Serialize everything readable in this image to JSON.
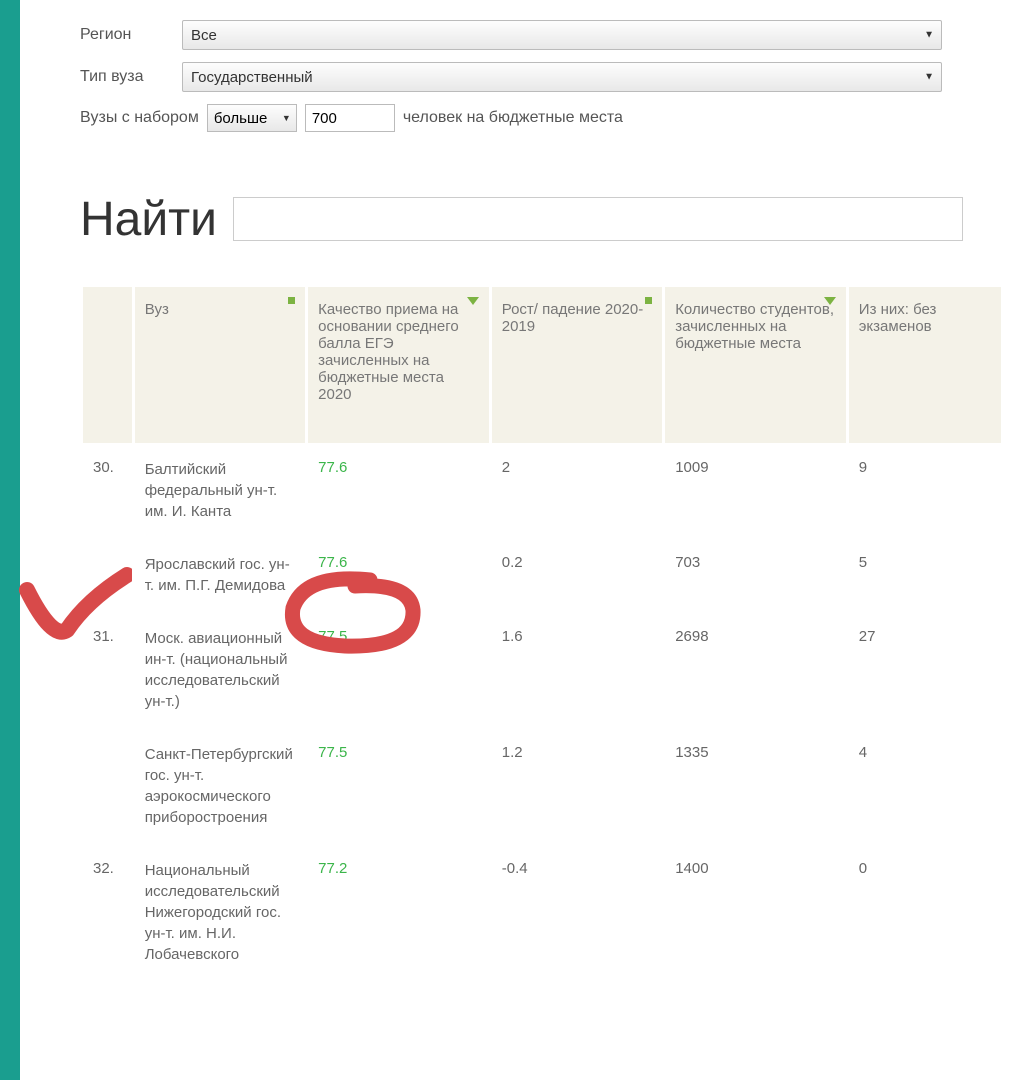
{
  "filters": {
    "region_label": "Регион",
    "region_value": "Все",
    "type_label": "Тип вуза",
    "type_value": "Государственный",
    "enroll_prefix": "Вузы с набором",
    "comparator": "больше",
    "threshold": "700",
    "enroll_suffix": "человек на бюджетные места"
  },
  "search": {
    "heading": "Найти",
    "value": ""
  },
  "columns": {
    "rank": "",
    "name": "Вуз",
    "quality": "Качество приема на основании среднего балла ЕГЭ зачисленных на бюджетные места 2020",
    "growth": "Рост/ падение 2020-2019",
    "students": "Количество студентов, зачисленных на бюджетные места",
    "noexam": "Из них: без экзаменов"
  },
  "rows": [
    {
      "rank": "30.",
      "name": "Балтийский федеральный ун-т. им. И. Канта",
      "quality": "77.6",
      "growth": "2",
      "students": "1009",
      "noexam": "9"
    },
    {
      "rank": "",
      "name": "Ярославский гос. ун-т. им. П.Г. Демидова",
      "quality": "77.6",
      "growth": "0.2",
      "students": "703",
      "noexam": "5"
    },
    {
      "rank": "31.",
      "name": "Моск. авиационный ин-т. (национальный исследовательский ун-т.)",
      "quality": "77.5",
      "growth": "1.6",
      "students": "2698",
      "noexam": "27"
    },
    {
      "rank": "",
      "name": "Санкт-Петербургский гос. ун-т. аэрокосмического приборостроения",
      "quality": "77.5",
      "growth": "1.2",
      "students": "1335",
      "noexam": "4"
    },
    {
      "rank": "32.",
      "name": "Национальный исследовательский Нижегородский гос. ун-т. им. Н.И. Лобачевского",
      "quality": "77.2",
      "growth": "-0.4",
      "students": "1400",
      "noexam": "0"
    }
  ]
}
